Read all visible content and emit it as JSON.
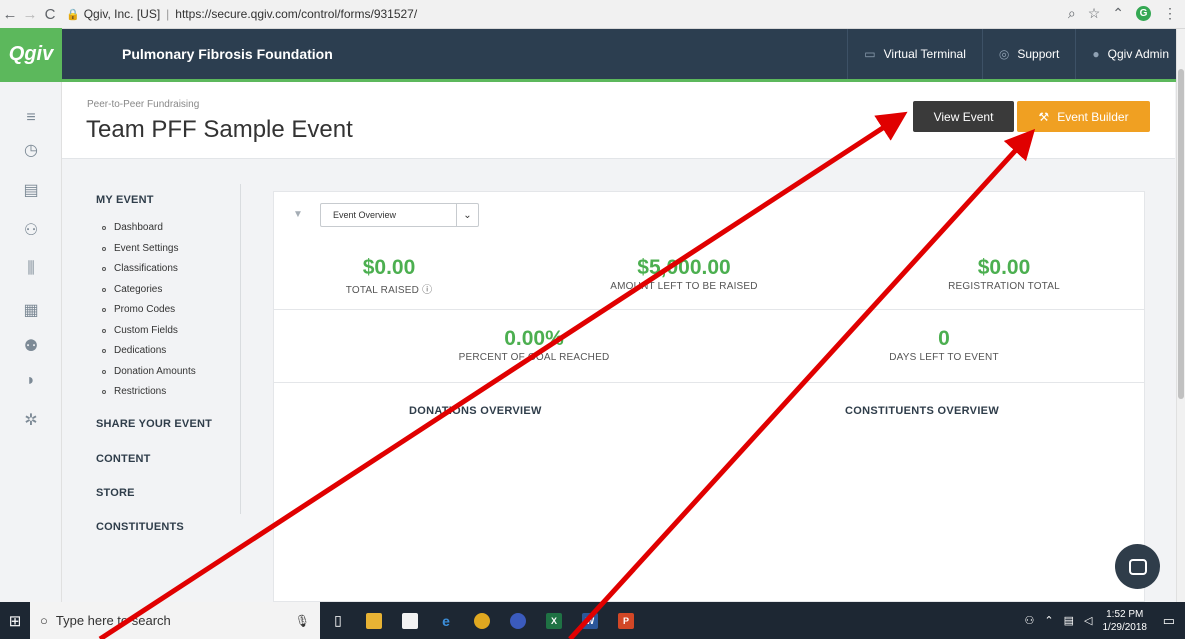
{
  "browser": {
    "back": "←",
    "forward": "→",
    "reload": "C",
    "site_name": "Qgiv, Inc. [US]",
    "url": "https://secure.qgiv.com/control/forms/931527/"
  },
  "header": {
    "logo": "Qgiv",
    "org_name": "Pulmonary Fibrosis Foundation",
    "links": [
      {
        "label": "Virtual Terminal",
        "icon": "card-icon"
      },
      {
        "label": "Support",
        "icon": "lifebuoy-icon"
      },
      {
        "label": "Qgiv Admin",
        "icon": "user-icon"
      }
    ]
  },
  "title_area": {
    "breadcrumb": "Peer-to-Peer Fundraising",
    "title": "Team PFF Sample Event",
    "view_event": "View Event",
    "event_builder": "Event Builder"
  },
  "subnav": {
    "my_event": "MY EVENT",
    "items": [
      "Dashboard",
      "Event Settings",
      "Classifications",
      "Categories",
      "Promo Codes",
      "Custom Fields",
      "Dedications",
      "Donation Amounts",
      "Restrictions"
    ],
    "share": "SHARE YOUR EVENT",
    "content": "CONTENT",
    "store": "STORE",
    "constituents": "CONSTITUENTS"
  },
  "dashboard": {
    "select_value": "Event Overview",
    "total_raised": {
      "value": "$0.00",
      "label": "TOTAL RAISED"
    },
    "amount_left": {
      "value": "$5,000.00",
      "label": "AMOUNT LEFT TO BE RAISED"
    },
    "registration_total": {
      "value": "$0.00",
      "label": "REGISTRATION TOTAL"
    },
    "percent_goal": {
      "value": "0.00%",
      "label": "PERCENT OF GOAL REACHED"
    },
    "days_left": {
      "value": "0",
      "label": "DAYS LEFT TO EVENT"
    },
    "donations_overview": "DONATIONS OVERVIEW",
    "constituents_overview": "CONSTITUENTS OVERVIEW"
  },
  "taskbar": {
    "search_placeholder": "Type here to search",
    "time": "1:52 PM",
    "date": "1/29/2018"
  },
  "colors": {
    "accent_green": "#4caf50",
    "header_navy": "#2c3e50",
    "builder_orange": "#f0a022",
    "arrow_red": "#e00000"
  }
}
